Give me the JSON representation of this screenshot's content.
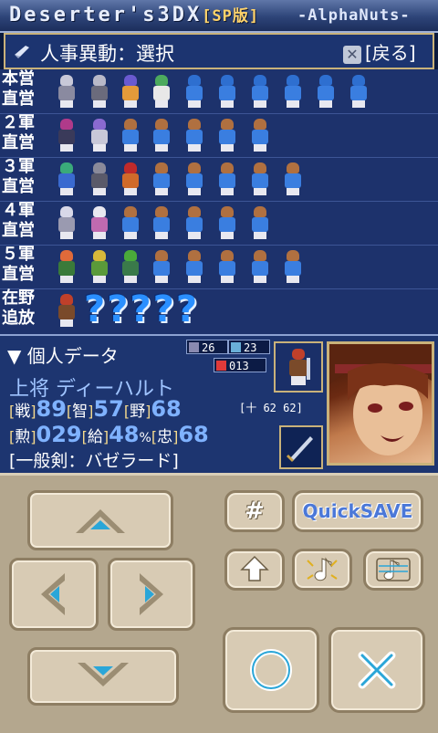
{
  "title": {
    "main": "Deserter's3DX",
    "edition": "[SP版]",
    "studio": "-AlphaNuts-"
  },
  "header": {
    "text": "人事異動：選択",
    "back_label": "[戻る]",
    "back_icon": "close-icon"
  },
  "roster": {
    "rows": [
      {
        "line1": "本営",
        "line2": "直営"
      },
      {
        "line1": "２軍",
        "line2": "直営"
      },
      {
        "line1": "３軍",
        "line2": "直営"
      },
      {
        "line1": "４軍",
        "line2": "直営"
      },
      {
        "line1": "５軍",
        "line2": "直営"
      },
      {
        "line1": "在野",
        "line2": "追放",
        "unknown": "?????"
      }
    ]
  },
  "data_panel": {
    "title": "▼ 個人データ",
    "mini_stats": [
      "26",
      "23",
      "013"
    ],
    "name": "上将 ディーハルト",
    "line1": {
      "b1": "[",
      "k1": "戦",
      "b2": "]",
      "v1": "89",
      "b3": "[",
      "k2": "智",
      "b4": "]",
      "v2": "57",
      "b5": "[",
      "k3": "野",
      "b6": "]",
      "v3": "68"
    },
    "extra": "[十 62  62]",
    "line2": {
      "b1": "[",
      "k1": "勲",
      "b2": "]",
      "v1": "029",
      "b3": "[",
      "k2": "給",
      "b4": "]",
      "v2": "48",
      "pct": "%",
      "b5": "[",
      "k3": "忠",
      "b6": "]",
      "v3": "68"
    },
    "weapon": "[一般剣：バゼラード]"
  },
  "controls": {
    "hash_label": "#",
    "quicksave_label": "QuickSAVE"
  },
  "colors": {
    "panel": "#1d326c",
    "accent_gold": "#c9b27a",
    "value_blue": "#7fb2ff",
    "control_bg": "#b4a78e"
  }
}
